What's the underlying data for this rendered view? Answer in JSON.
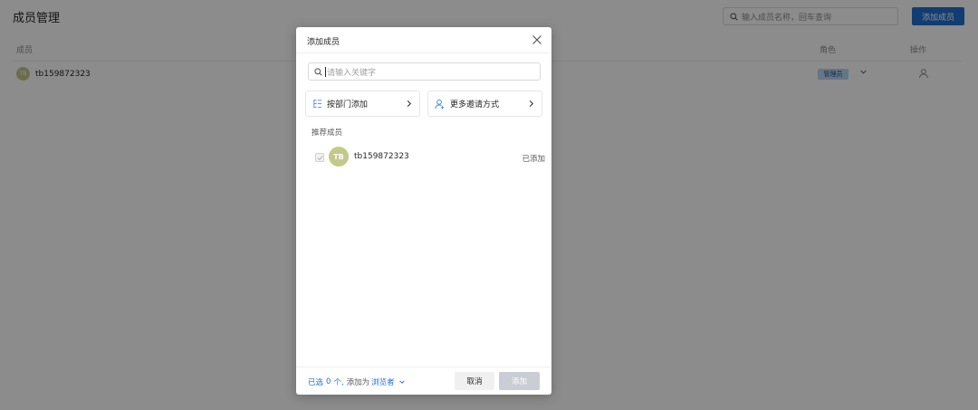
{
  "page": {
    "title": "成员管理",
    "search_placeholder": "输入成员名称，回车查询",
    "add_member_button": "添加成员",
    "columns": {
      "member": "成员",
      "role": "角色",
      "actions": "操作"
    },
    "rows": [
      {
        "avatar": "TB",
        "name": "tb159872323",
        "role": "管理员"
      }
    ]
  },
  "modal": {
    "title": "添加成员",
    "search_placeholder": "请输入关键字",
    "options": {
      "by_department": "按部门添加",
      "more_invites": "更多邀请方式"
    },
    "recommended_title": "推荐成员",
    "recommended": [
      {
        "avatar": "TB",
        "name": "tb159872323",
        "status": "已添加"
      }
    ],
    "footer": {
      "prefix": "已选",
      "count": "0",
      "unit": "个,",
      "add_as": "添加为",
      "role": "浏览者",
      "cancel": "取消",
      "confirm": "添加"
    }
  },
  "colors": {
    "primary": "#1f6fd1",
    "avatar": "#c2c98a",
    "role_tag": "#b8d8f3",
    "disabled_button": "#c9cdd4"
  }
}
